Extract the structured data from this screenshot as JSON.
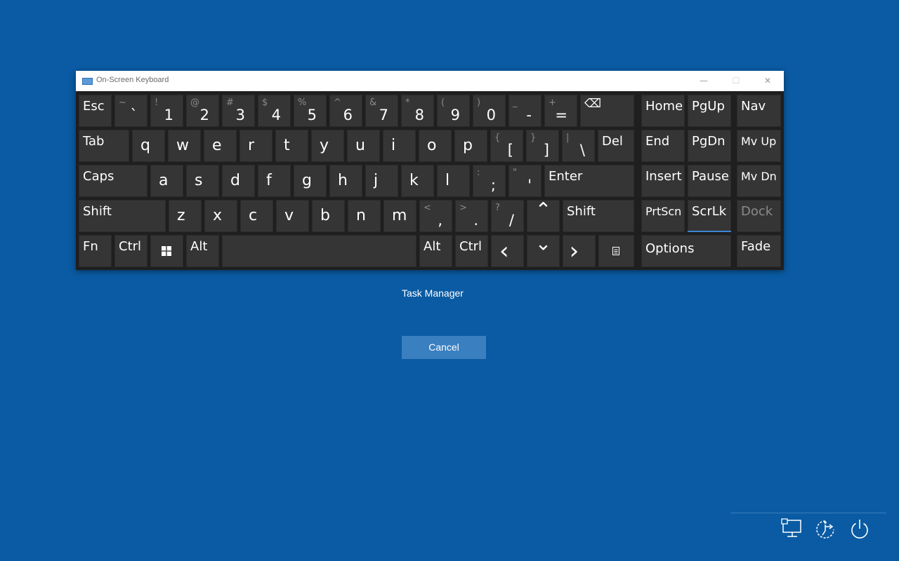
{
  "window": {
    "title": "On-Screen Keyboard",
    "minimize": "—",
    "maximize": "☐",
    "close": "✕"
  },
  "keys": {
    "esc": "Esc",
    "tilde": {
      "shift": "~",
      "base": "`"
    },
    "n1": {
      "shift": "!",
      "base": "1"
    },
    "n2": {
      "shift": "@",
      "base": "2"
    },
    "n3": {
      "shift": "#",
      "base": "3"
    },
    "n4": {
      "shift": "$",
      "base": "4"
    },
    "n5": {
      "shift": "%",
      "base": "5"
    },
    "n6": {
      "shift": "^",
      "base": "6"
    },
    "n7": {
      "shift": "&",
      "base": "7"
    },
    "n8": {
      "shift": "*",
      "base": "8"
    },
    "n9": {
      "shift": "(",
      "base": "9"
    },
    "n0": {
      "shift": ")",
      "base": "0"
    },
    "minus": {
      "shift": "_",
      "base": "-"
    },
    "equal": {
      "shift": "+",
      "base": "="
    },
    "backspace": "⌫",
    "home": "Home",
    "pgup": "PgUp",
    "nav": "Nav",
    "tab": "Tab",
    "q": "q",
    "w": "w",
    "e": "e",
    "r": "r",
    "t": "t",
    "y": "y",
    "u": "u",
    "i": "i",
    "o": "o",
    "p": "p",
    "lbracket": {
      "shift": "{",
      "base": "["
    },
    "rbracket": {
      "shift": "}",
      "base": "]"
    },
    "backslash": {
      "shift": "|",
      "base": "\\"
    },
    "del": "Del",
    "end": "End",
    "pgdn": "PgDn",
    "mvup": "Mv Up",
    "caps": "Caps",
    "a": "a",
    "s": "s",
    "d": "d",
    "f": "f",
    "g": "g",
    "h": "h",
    "j": "j",
    "k": "k",
    "l": "l",
    "semicolon": {
      "shift": ":",
      "base": ";"
    },
    "quote": {
      "shift": "\"",
      "base": "'"
    },
    "enter": "Enter",
    "insert": "Insert",
    "pause": "Pause",
    "mvdn": "Mv Dn",
    "shift_left": "Shift",
    "z": "z",
    "x": "x",
    "c": "c",
    "v": "v",
    "b": "b",
    "n": "n",
    "m": "m",
    "comma": {
      "shift": "<",
      "base": ","
    },
    "period": {
      "shift": ">",
      "base": "."
    },
    "slash": {
      "shift": "?",
      "base": "/"
    },
    "up": "⌃",
    "shift_right": "Shift",
    "prtscn": "PrtScn",
    "scrlk": "ScrLk",
    "dock": "Dock",
    "fn": "Fn",
    "ctrl_left": "Ctrl",
    "win": "windows-icon",
    "alt_left": "Alt",
    "alt_right": "Alt",
    "ctrl_right": "Ctrl",
    "left": "‹",
    "down": "⌄",
    "right": "›",
    "menu": "menu-icon",
    "options": "Options",
    "fade": "Fade"
  },
  "caption": "Task Manager",
  "cancel_label": "Cancel",
  "tray_icons": [
    "network-icon",
    "accessibility-icon",
    "power-icon"
  ],
  "colors": {
    "background": "#0a5ba3",
    "key": "#353535",
    "button": "#3a7fc0"
  }
}
